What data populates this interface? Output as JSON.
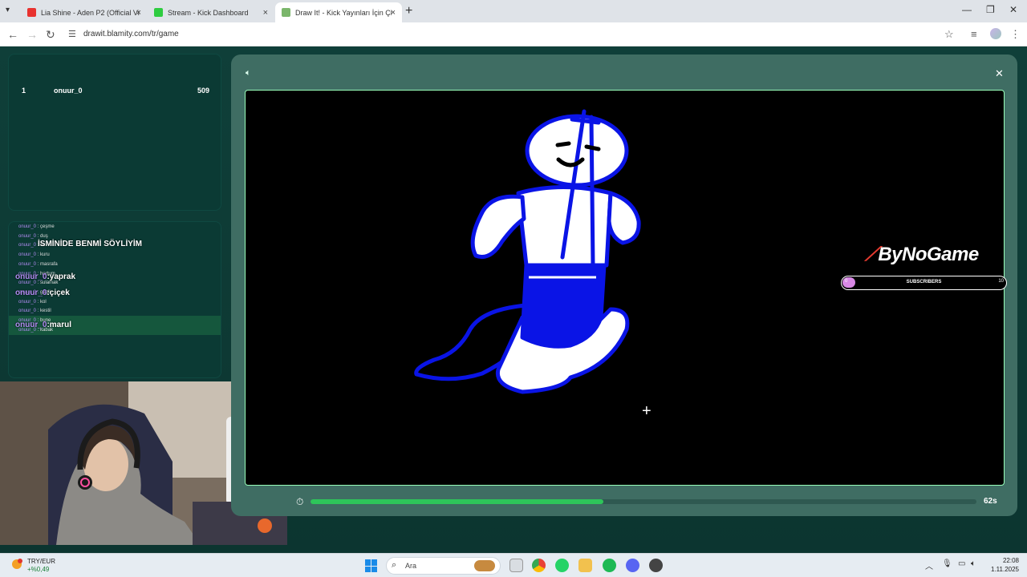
{
  "browser": {
    "tabs": [
      {
        "title": "Lia Shine - Aden P2 (Official Vi",
        "active": false
      },
      {
        "title": "Stream - Kick Dashboard",
        "active": false
      },
      {
        "title": "Draw It! - Kick Yayınları İçin Çiz",
        "active": true
      }
    ],
    "url": "drawit.blamity.com/tr/game",
    "new_tab": "+",
    "close_glyph": "×"
  },
  "leaderboard": {
    "rows": [
      {
        "rank": "1",
        "name": "onuur_0",
        "score": "509"
      }
    ]
  },
  "chat": {
    "messages": [
      {
        "user": "onuur_0",
        "text": "çeşme"
      },
      {
        "user": "onuur_0",
        "text": "duş"
      },
      {
        "user": "onuur_0",
        "text": "su"
      },
      {
        "user": "onuur_0",
        "text": "kuru"
      },
      {
        "user": "onuur_0",
        "text": "masrafa"
      },
      {
        "user": "onuur_0",
        "text": "hortum"
      },
      {
        "user": "onuur_0",
        "text": "sulamak"
      },
      {
        "user": "onuur_0",
        "text": "gagil"
      },
      {
        "user": "onuur_0",
        "text": "kol"
      },
      {
        "user": "onuur_0",
        "text": "kestil"
      },
      {
        "user": "onuur_0",
        "text": "bune"
      },
      {
        "user": "onuur_0",
        "text": "kabak"
      }
    ],
    "overlay": {
      "heading": "İSMİNİDE BENMİ SÖYLİYİM",
      "lines": [
        {
          "user": "onuur_0",
          "text": ":yaprak"
        },
        {
          "user": "onuur_0",
          "text": ":çiçek"
        },
        {
          "user": "onuur_0",
          "text": ":marul"
        }
      ]
    }
  },
  "game": {
    "brand": "ByNoGame",
    "subscribers_label": "SUBSCRIBERS",
    "subscribers_current": "0",
    "subscribers_goal": "10",
    "timer": "62s",
    "progress": 0.44
  },
  "taskbar": {
    "fx_name": "TRY/EUR",
    "fx_value": "+%0,49",
    "search_placeholder": "Ara",
    "time": "22:08",
    "date": "1.11.2025"
  }
}
